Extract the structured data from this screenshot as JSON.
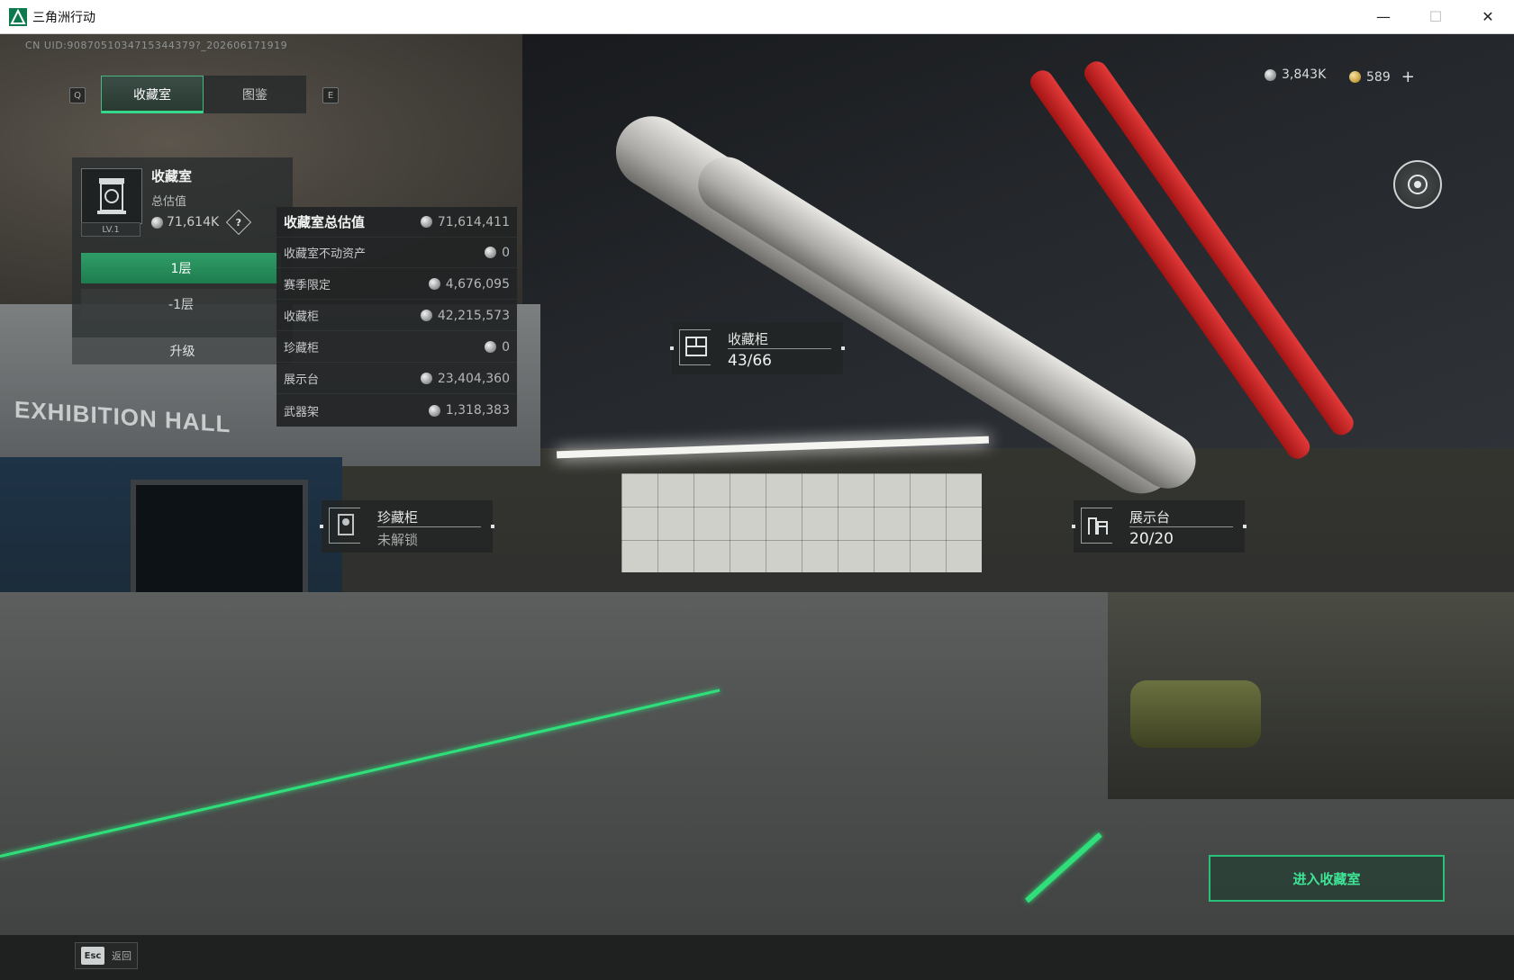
{
  "window": {
    "title": "三角洲行动",
    "controls": {
      "minimize": "—",
      "maximize": "☐",
      "close": "✕"
    }
  },
  "uid": "CN UID:9087051034715344379?_202606171919",
  "tabs": {
    "left_key": "Q",
    "right_key": "E",
    "items": [
      {
        "label": "收藏室",
        "active": true
      },
      {
        "label": "图鉴",
        "active": false
      }
    ]
  },
  "room": {
    "title": "收藏室",
    "subtitle": "总估值",
    "value": "71,614K",
    "level": "LV.1",
    "help": "?",
    "floors": [
      "1层",
      "-1层"
    ],
    "upgrade": "升级"
  },
  "value_panel": {
    "header": {
      "label": "收藏室总估值",
      "value": "71,614,411"
    },
    "rows": [
      {
        "label": "收藏室不动资产",
        "value": "0"
      },
      {
        "label": "赛季限定",
        "value": "4,676,095"
      },
      {
        "label": "收藏柜",
        "value": "42,215,573"
      },
      {
        "label": "珍藏柜",
        "value": "0"
      },
      {
        "label": "展示台",
        "value": "23,404,360"
      },
      {
        "label": "武器架",
        "value": "1,318,383"
      }
    ]
  },
  "map_labels": {
    "cabinet": {
      "name": "收藏柜",
      "count": "43/66"
    },
    "treasure": {
      "name": "珍藏柜",
      "count": "未解锁"
    },
    "display": {
      "name": "展示台",
      "count": "20/20"
    }
  },
  "scene_sign": "EXHIBITION HALL",
  "currency": {
    "silver": "3,843K",
    "gold": "589",
    "plus": "+"
  },
  "enter_button": "进入收藏室",
  "back": {
    "key": "Esc",
    "label": "返回"
  },
  "colors": {
    "accent_green": "#34d98b",
    "button_green": "#2f9d67",
    "panel_bg": "#212425"
  }
}
